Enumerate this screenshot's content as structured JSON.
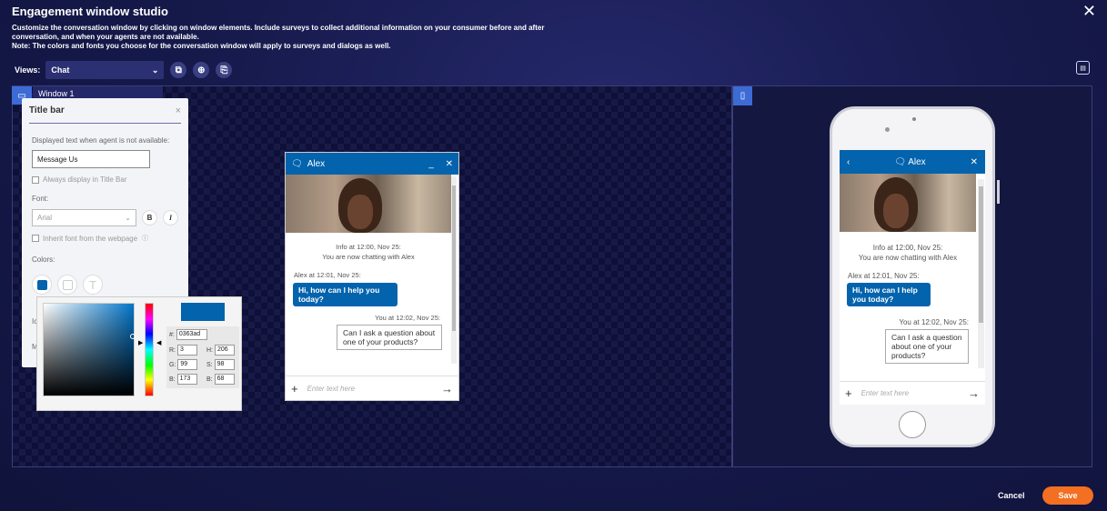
{
  "header": {
    "title": "Engagement window studio",
    "desc_line1": "Customize the conversation window by clicking on window elements. Include surveys to collect additional information on your consumer before and after conversation, and when your agents are not available.",
    "desc_line2": "Note: The colors and fonts you choose for the conversation window will apply to surveys and dialogs as well.",
    "close_glyph": "✕"
  },
  "toolbar": {
    "views_label": "Views:",
    "views_value": "Chat",
    "icons": [
      "copy-icon",
      "add-icon",
      "duplicate-icon"
    ]
  },
  "window_tab": "Window 1",
  "panel": {
    "title": "Title bar",
    "close": "×",
    "agent_label": "Displayed text when agent is not available:",
    "agent_value": "Message Us",
    "always_display": "Always display in Title Bar",
    "font_label": "Font:",
    "font_value": "Arial",
    "bold": "B",
    "italic": "I",
    "inherit_font": "Inherit font from the webpage",
    "colors_label": "Colors:",
    "truncated_1": "Ic",
    "truncated_2": "M"
  },
  "color_picker": {
    "hex_label": "#:",
    "hex": "0363ad",
    "r_label": "R:",
    "r": "3",
    "g_label": "G:",
    "g": "99",
    "b_label": "B:",
    "b": "173",
    "h_label": "H:",
    "h": "206",
    "s_label": "S:",
    "s": "98",
    "br_label": "B:",
    "br": "68",
    "accent": "#0363ad"
  },
  "chat": {
    "agent_name": "Alex",
    "info_line1": "Info at 12:00, Nov 25:",
    "info_line2": "You are now chatting with Alex",
    "agent_stamp": "Alex at 12:01, Nov 25:",
    "agent_msg": "Hi, how can I help you today?",
    "you_stamp": "You at 12:02, Nov 25:",
    "you_msg": "Can I ask a question about one of your products?",
    "input_placeholder": "Enter text here"
  },
  "mobile_chat": {
    "agent_name": "Alex",
    "info_line1": "Info at 12:00, Nov 25:",
    "info_line2": "You are now chatting with Alex",
    "agent_stamp": "Alex at 12:01, Nov 25:",
    "agent_msg": "Hi, how can I help you today?",
    "you_stamp": "You at 12:02, Nov 25:",
    "you_msg": "Can I ask a question about one of your products?",
    "input_placeholder": "Enter text here"
  },
  "footer": {
    "cancel": "Cancel",
    "save": "Save",
    "save_color": "#f36f21"
  }
}
